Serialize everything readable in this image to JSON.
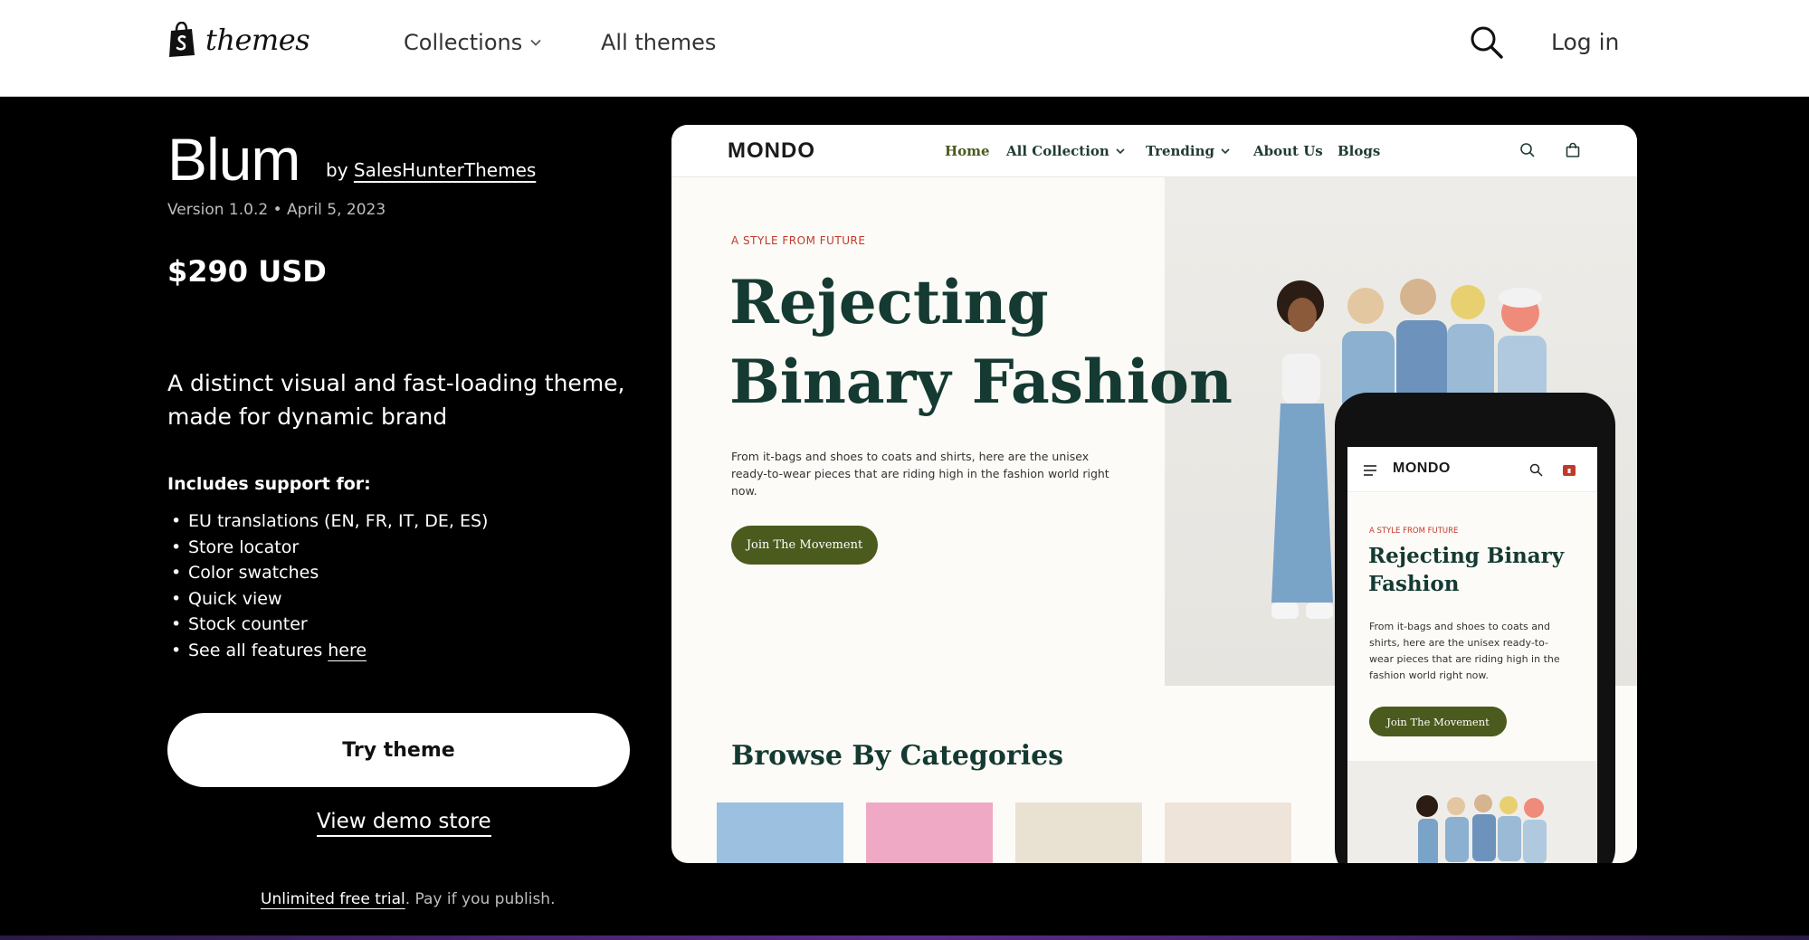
{
  "header": {
    "brand": "themes",
    "nav": [
      {
        "label": "Collections"
      },
      {
        "label": "All themes"
      }
    ],
    "login_label": "Log in"
  },
  "theme": {
    "name": "Blum",
    "by_prefix": "by",
    "author": "SalesHunterThemes",
    "version": "Version 1.0.2",
    "separator": "•",
    "date": "April 5, 2023",
    "price": "$290 USD",
    "tagline": "A distinct visual and fast-loading theme, made for dynamic brand",
    "support_title": "Includes support for:",
    "features": [
      "EU translations (EN, FR, IT, DE, ES)",
      "Store locator",
      "Color swatches",
      "Quick view",
      "Stock counter"
    ],
    "features_last_prefix": "See all features",
    "features_last_link": "here",
    "try_label": "Try theme",
    "demo_label": "View demo store",
    "trial_link": "Unlimited free trial",
    "trial_suffix": ". Pay if you publish."
  },
  "preview": {
    "logo": "MONDO",
    "nav": [
      {
        "label": "Home"
      },
      {
        "label": "All Collection"
      },
      {
        "label": "Trending"
      },
      {
        "label": "About Us"
      },
      {
        "label": "Blogs"
      }
    ],
    "kicker": "A STYLE FROM FUTURE",
    "headline": "Rejecting Binary Fashion",
    "description": "From it-bags and shoes to coats and shirts, here are the unisex ready-to-wear pieces that are riding high in the fashion world right now.",
    "cta": "Join The Movement",
    "browse_title": "Browse By Categories",
    "phone": {
      "logo": "MONDO",
      "kicker": "A STYLE FROM FUTURE",
      "headline": "Rejecting Binary Fashion",
      "description": "From it-bags and shoes to coats and shirts, here are the unisex ready-to-wear pieces that are riding high in the fashion world right now.",
      "cta": "Join The Movement"
    }
  },
  "colors": {
    "accent_green": "#4b5a1d",
    "headline_green": "#143a32",
    "kicker_red": "#c0392b"
  }
}
